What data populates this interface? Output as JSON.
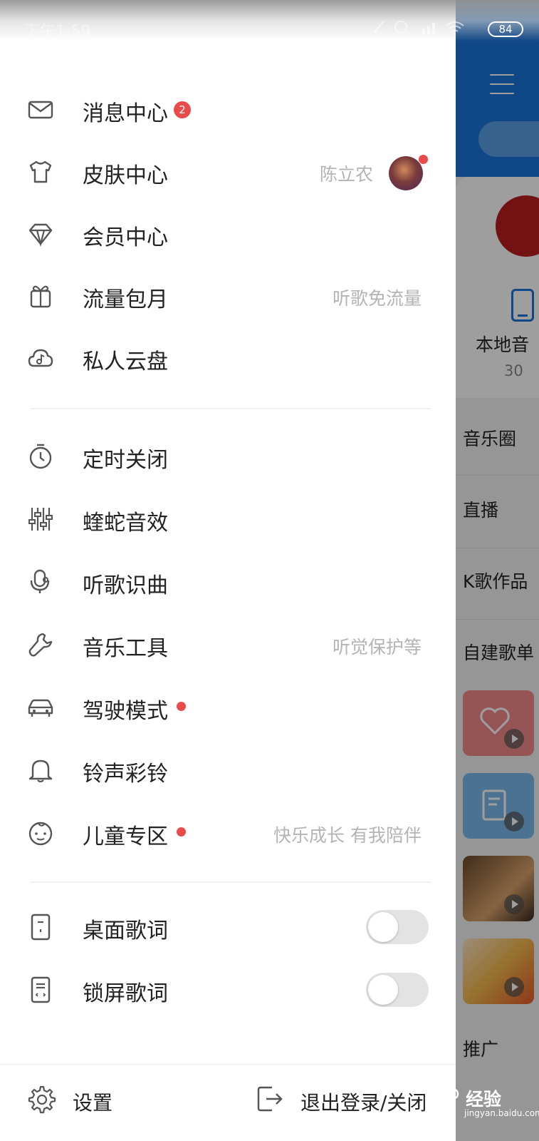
{
  "status_bar": {
    "time": "下午1:59",
    "battery": "84"
  },
  "menu_group_1": [
    {
      "label": "消息中心",
      "icon": "mail-icon",
      "badge": "2"
    },
    {
      "label": "皮肤中心",
      "icon": "tshirt-icon",
      "right_text": "陈立农"
    },
    {
      "label": "会员中心",
      "icon": "diamond-icon"
    },
    {
      "label": "流量包月",
      "icon": "gift-icon",
      "right_text": "听歌免流量"
    },
    {
      "label": "私人云盘",
      "icon": "cloud-music-icon"
    }
  ],
  "menu_group_2": [
    {
      "label": "定时关闭",
      "icon": "timer-icon"
    },
    {
      "label": "蝰蛇音效",
      "icon": "equalizer-icon"
    },
    {
      "label": "听歌识曲",
      "icon": "song-recognition-icon"
    },
    {
      "label": "音乐工具",
      "icon": "wrench-icon",
      "right_text": "听觉保护等"
    },
    {
      "label": "驾驶模式",
      "icon": "car-icon"
    },
    {
      "label": "铃声彩铃",
      "icon": "bell-icon"
    },
    {
      "label": "儿童专区",
      "icon": "baby-face-icon",
      "right_text": "快乐成长 有我陪伴"
    }
  ],
  "toggles": [
    {
      "label": "桌面歌词",
      "icon": "desktop-lyrics-icon",
      "on": false
    },
    {
      "label": "锁屏歌词",
      "icon": "lockscreen-lyrics-icon",
      "on": false
    }
  ],
  "bottom": {
    "settings": "设置",
    "logout": "退出登录/关闭"
  },
  "background_app": {
    "local_label": "本地音",
    "local_count": "30",
    "sections": [
      "音乐圈",
      "直播",
      "K歌作品",
      "自建歌单",
      "推广"
    ]
  },
  "watermark": {
    "text": "经验",
    "url": "jingyan.baidu.com"
  },
  "colors": {
    "accent_blue": "#1a73d8",
    "badge_red": "#e94b4b",
    "secondary_text": "#b4b4b4"
  }
}
